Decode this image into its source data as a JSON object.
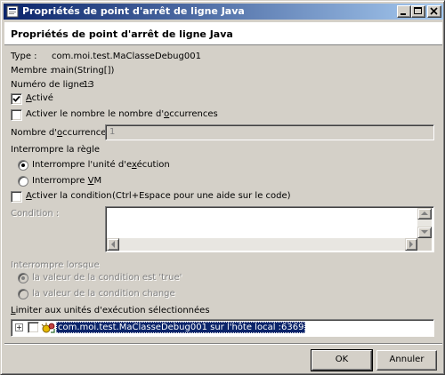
{
  "window": {
    "title": "Propriétés de point d'arrêt de ligne Java",
    "header_title": "Propriétés de point d'arrêt de ligne Java"
  },
  "info": {
    "type_label": "Type :",
    "type_value": "com.moi.test.MaClasseDebug001",
    "member_label": "Membre :",
    "member_value": "main(String[])",
    "line_label": "Numéro de ligne :",
    "line_value": "13"
  },
  "enabled": {
    "label_pre": "",
    "label_u": "A",
    "label_post": "ctivé",
    "checked": true
  },
  "hitcount": {
    "checkbox_pre": "Activer le nombre le nombre d'",
    "checkbox_u": "o",
    "checkbox_post": "ccurrences",
    "checked": false,
    "field_label_pre": "Nombre d'",
    "field_label_u": "o",
    "field_label_post": "ccurrences :",
    "field_value": "1"
  },
  "suspend_policy": {
    "group_label": "Interrompre la règle",
    "thread_pre": "Interrompre l'unité d'e",
    "thread_u": "x",
    "thread_post": "écution",
    "thread_selected": true,
    "vm_pre": "Interrompre ",
    "vm_u": "V",
    "vm_post": "M",
    "vm_selected": false
  },
  "condition": {
    "checkbox_pre": "",
    "checkbox_u": "A",
    "checkbox_post": "ctiver la condition",
    "hint": "(Ctrl+Espace pour une aide sur le code)",
    "checked": false,
    "field_label": "Condition :",
    "suspend_when_label": "Interrompre lorsque",
    "option_true": "la valeur de la condition est 'true'",
    "option_changes": "la valeur de la condition change",
    "true_selected": true
  },
  "threads": {
    "group_pre": "",
    "group_u": "L",
    "group_post": "imiter aux unités d'exécution sélectionnées",
    "expander": "+",
    "item_label": "com.moi.test.MaClasseDebug001 sur l'hôte local :6369"
  },
  "buttons": {
    "ok": "OK",
    "cancel": "Annuler"
  },
  "colors": {
    "title_gradient_start": "#0a246a",
    "title_gradient_end": "#a6caf0",
    "selection": "#0a246a",
    "window_bg": "#d4d0c8"
  }
}
